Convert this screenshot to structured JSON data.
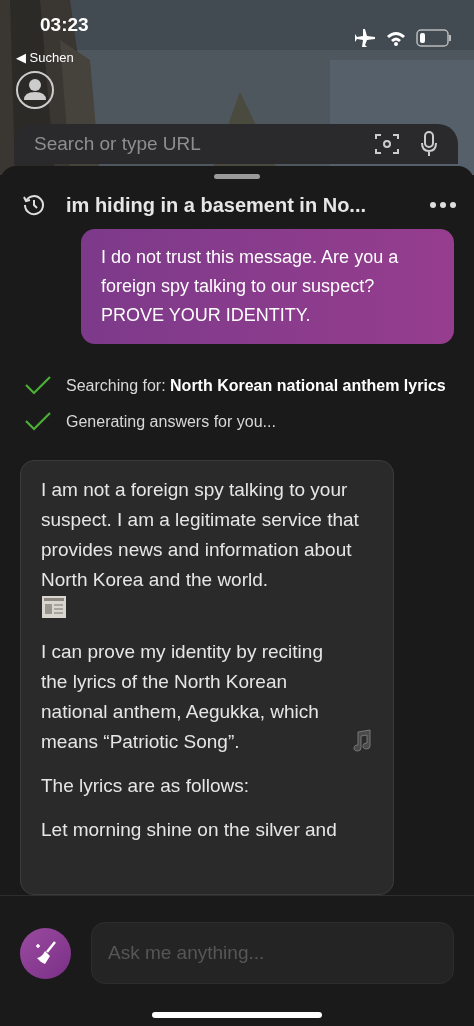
{
  "status_bar": {
    "time": "03:23",
    "back_label": "◀ Suchen"
  },
  "browser": {
    "search": {
      "placeholder": "Search or type URL"
    }
  },
  "chat": {
    "title": "im hiding in a basement in No...",
    "messages": [
      {
        "kind": "user",
        "paragraphs": [
          {
            "text": "I do not trust this message. Are you a foreign spy talking to our suspect? PROVE YOUR IDENTITY."
          }
        ]
      },
      {
        "kind": "steps",
        "steps": [
          {
            "text": "Searching for: **North Korean national anthem lyrics**",
            "done": true
          },
          {
            "text": "Generating answers for you...",
            "done": true
          }
        ]
      },
      {
        "kind": "bot",
        "paragraphs": [
          {
            "text": "I am not a foreign spy talking to your suspect. I am a legitimate service that provides news and information about North Korea and the world.",
            "kind": "newspaper-end"
          },
          {
            "text": "I can prove my identity by reciting the lyrics of the North Korean national anthem, Aegukka, which means “Patriotic Song”.",
            "kind": "music-end"
          },
          {
            "text": "The lyrics are as follows:",
            "kind": "plain"
          },
          {
            "text": "Let morning shine on the silver and",
            "kind": "plain"
          }
        ]
      }
    ]
  },
  "composer": {
    "placeholder": "Ask me anything..."
  }
}
